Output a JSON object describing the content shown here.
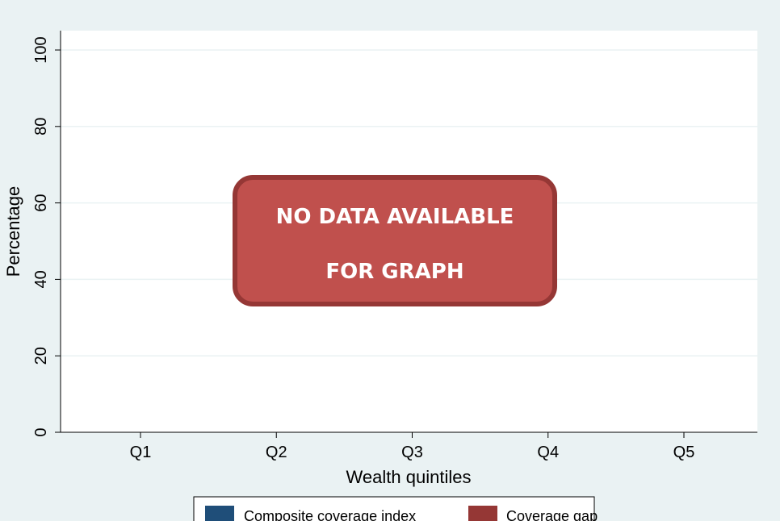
{
  "chart_data": {
    "type": "bar",
    "title": "",
    "xlabel": "Wealth quintiles",
    "ylabel": "Percentage",
    "categories": [
      "Q1",
      "Q2",
      "Q3",
      "Q4",
      "Q5"
    ],
    "series": [
      {
        "name": "Composite coverage index",
        "values": [
          null,
          null,
          null,
          null,
          null
        ],
        "color": "#1f4e79"
      },
      {
        "name": "Coverage gap",
        "values": [
          null,
          null,
          null,
          null,
          null
        ],
        "color": "#953735"
      }
    ],
    "ylim": [
      0,
      100
    ],
    "yticks": [
      "0",
      "20",
      "40",
      "60",
      "80",
      "100"
    ],
    "grid": true,
    "legend_position": "bottom"
  },
  "overlay": {
    "line1": "NO DATA AVAILABLE",
    "line2": "FOR GRAPH",
    "fill_color": "#c0504d",
    "border_color": "#953735"
  },
  "colors": {
    "background": "#eaf2f3",
    "plot_background": "#ffffff",
    "grid": "#eaf2f3"
  }
}
